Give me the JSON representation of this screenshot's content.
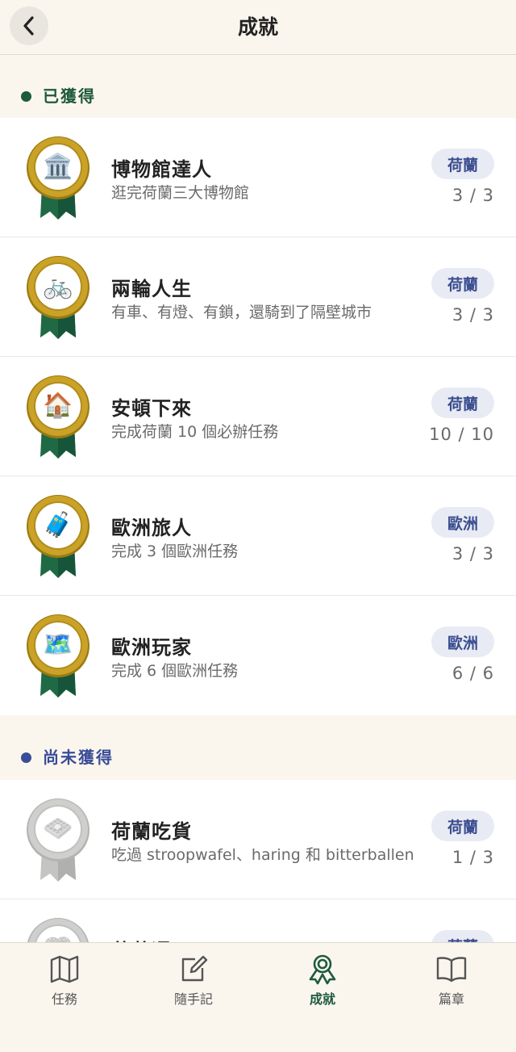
{
  "header": {
    "title": "成就"
  },
  "earned": {
    "title": "已獲得",
    "dot_color": "#1e5a3c",
    "items": [
      {
        "icon": "museum-icon",
        "emoji": "🏛️",
        "title": "博物館達人",
        "desc": "逛完荷蘭三大博物館",
        "tag": "荷蘭",
        "progress": "3 / 3",
        "fraction": 1.0
      },
      {
        "icon": "bicycle-icon",
        "emoji": "🚲",
        "title": "兩輪人生",
        "desc": "有車、有燈、有鎖，還騎到了隔壁城市",
        "tag": "荷蘭",
        "progress": "3 / 3",
        "fraction": 1.0
      },
      {
        "icon": "house-icon",
        "emoji": "🏠",
        "title": "安頓下來",
        "desc": "完成荷蘭 10 個必辦任務",
        "tag": "荷蘭",
        "progress": "10 / 10",
        "fraction": 1.0
      },
      {
        "icon": "suitcase-icon",
        "emoji": "🧳",
        "title": "歐洲旅人",
        "desc": "完成 3 個歐洲任務",
        "tag": "歐洲",
        "progress": "3 / 3",
        "fraction": 1.0
      },
      {
        "icon": "map-icon",
        "emoji": "🗺️",
        "title": "歐洲玩家",
        "desc": "完成 6 個歐洲任務",
        "tag": "歐洲",
        "progress": "6 / 6",
        "fraction": 1.0
      }
    ]
  },
  "unearned": {
    "title": "尚未獲得",
    "dot_color": "#3a4d98",
    "items": [
      {
        "icon": "waffle-icon",
        "emoji": "🧇",
        "title": "荷蘭吃貨",
        "desc": "吃過 stroopwafel、haring 和 bitterballen",
        "tag": "荷蘭",
        "progress": "1 / 3",
        "fraction": 0.333
      },
      {
        "icon": "pretzel-icon",
        "emoji": "🥨",
        "title": "荷蘭通",
        "desc": "",
        "tag": "荷蘭",
        "progress": "",
        "fraction": null
      }
    ]
  },
  "tabs": [
    {
      "name": "tab-tasks",
      "icon": "map-outline-icon",
      "label": "任務",
      "active": false
    },
    {
      "name": "tab-notes",
      "icon": "edit-icon",
      "label": "隨手記",
      "active": false
    },
    {
      "name": "tab-achievements",
      "icon": "ribbon-icon",
      "label": "成就",
      "active": true
    },
    {
      "name": "tab-chapters",
      "icon": "book-icon",
      "label": "篇章",
      "active": false
    }
  ],
  "colors": {
    "background": "#faf6ee",
    "accent_green": "#1e5a3c",
    "accent_blue": "#3a4d98",
    "tag_background": "#e8ebf4",
    "gold": "#c9a227",
    "silver": "#c8c8c6"
  }
}
